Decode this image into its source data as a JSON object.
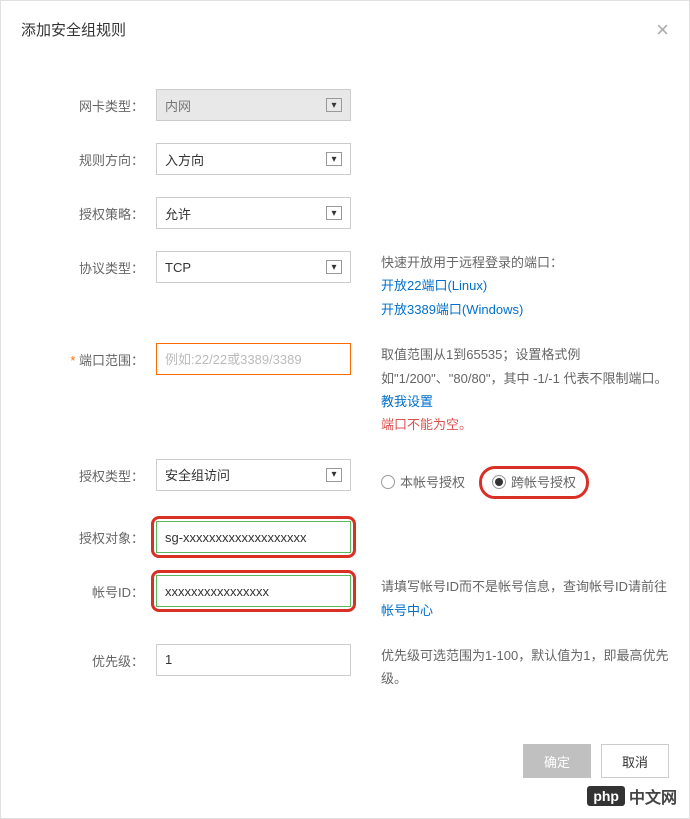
{
  "title": "添加安全组规则",
  "fields": {
    "nic": {
      "label": "网卡类型：",
      "value": "内网"
    },
    "direction": {
      "label": "规则方向：",
      "value": "入方向"
    },
    "policy": {
      "label": "授权策略：",
      "value": "允许"
    },
    "protocol": {
      "label": "协议类型：",
      "value": "TCP",
      "hint": "快速开放用于远程登录的端口：",
      "link1": "开放22端口(Linux)",
      "link2": "开放3389端口(Windows)"
    },
    "port": {
      "label": "端口范围：",
      "placeholder": "例如:22/22或3389/3389",
      "hint": "取值范围从1到65535；设置格式例如\"1/200\"、\"80/80\"，其中 -1/-1 代表不限制端口。 ",
      "hint_link": "教我设置",
      "error": "端口不能为空。"
    },
    "auth_type": {
      "label": "授权类型：",
      "value": "安全组访问",
      "option1": "本帐号授权",
      "option2": "跨帐号授权"
    },
    "auth_object": {
      "label": "授权对象：",
      "value": "sg-xxxxxxxxxxxxxxxxxxx"
    },
    "account_id": {
      "label": "帐号ID：",
      "value": "xxxxxxxxxxxxxxxx",
      "hint": "请填写帐号ID而不是帐号信息，查询帐号ID请前往 ",
      "hint_link": "帐号中心"
    },
    "priority": {
      "label": "优先级：",
      "value": "1",
      "hint": "优先级可选范围为1-100，默认值为1，即最高优先级。"
    }
  },
  "buttons": {
    "ok": "确定",
    "cancel": "取消"
  },
  "watermark": {
    "logo": "php",
    "text": "中文网"
  }
}
